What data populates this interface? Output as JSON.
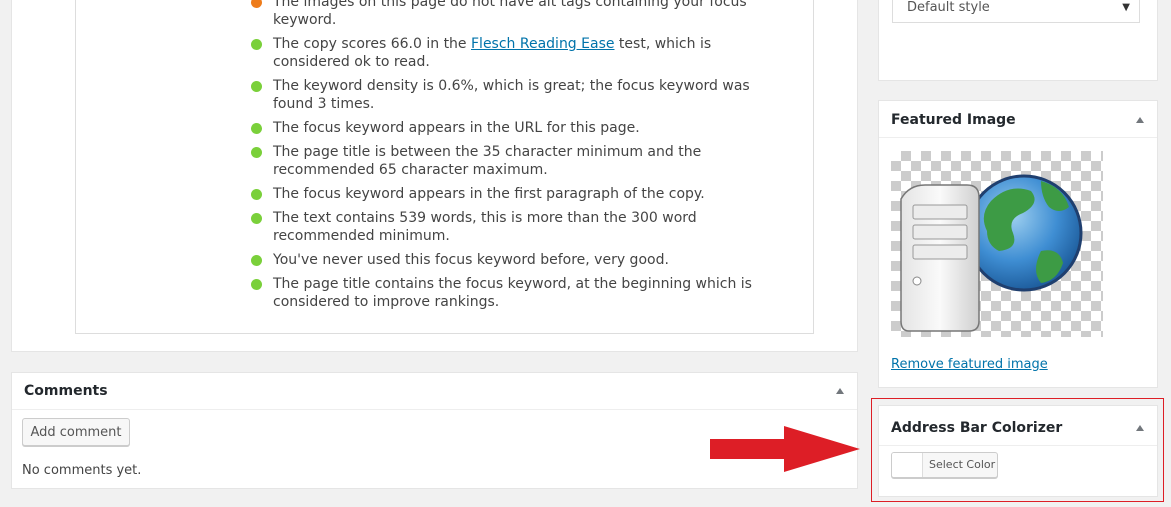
{
  "seo": {
    "items": [
      {
        "status": "orange",
        "text": "The images on this page do not have alt tags containing your focus keyword."
      },
      {
        "status": "green",
        "text_before": "The copy scores 66.0 in the ",
        "link": "Flesch Reading Ease",
        "text_after": " test, which is considered ok to read."
      },
      {
        "status": "green",
        "text": "The keyword density is 0.6%, which is great; the focus keyword was found 3 times."
      },
      {
        "status": "green",
        "text": "The focus keyword appears in the URL for this page."
      },
      {
        "status": "green",
        "text": "The page title is between the 35 character minimum and the recommended 65 character maximum."
      },
      {
        "status": "green",
        "text": "The focus keyword appears in the first paragraph of the copy."
      },
      {
        "status": "green",
        "text": "The text contains 539 words, this is more than the 300 word recommended minimum."
      },
      {
        "status": "green",
        "text": "You've never used this focus keyword before, very good."
      },
      {
        "status": "green",
        "text": "The page title contains the focus keyword, at the beginning which is considered to improve rankings."
      }
    ],
    "colors": {
      "orange": "#ee7c1b",
      "green": "#7ad03a"
    }
  },
  "comments": {
    "title": "Comments",
    "add_button": "Add comment",
    "empty_text": "No comments yet."
  },
  "format": {
    "selected": "Default style"
  },
  "featured": {
    "title": "Featured Image",
    "remove_link": "Remove featured image",
    "image_icon": "server-globe-icon"
  },
  "address_bar": {
    "title": "Address Bar Colorizer",
    "button_label": "Select Color"
  },
  "annotation": {
    "arrow_color": "#dd1e26",
    "highlight_color": "#dd1e26"
  }
}
